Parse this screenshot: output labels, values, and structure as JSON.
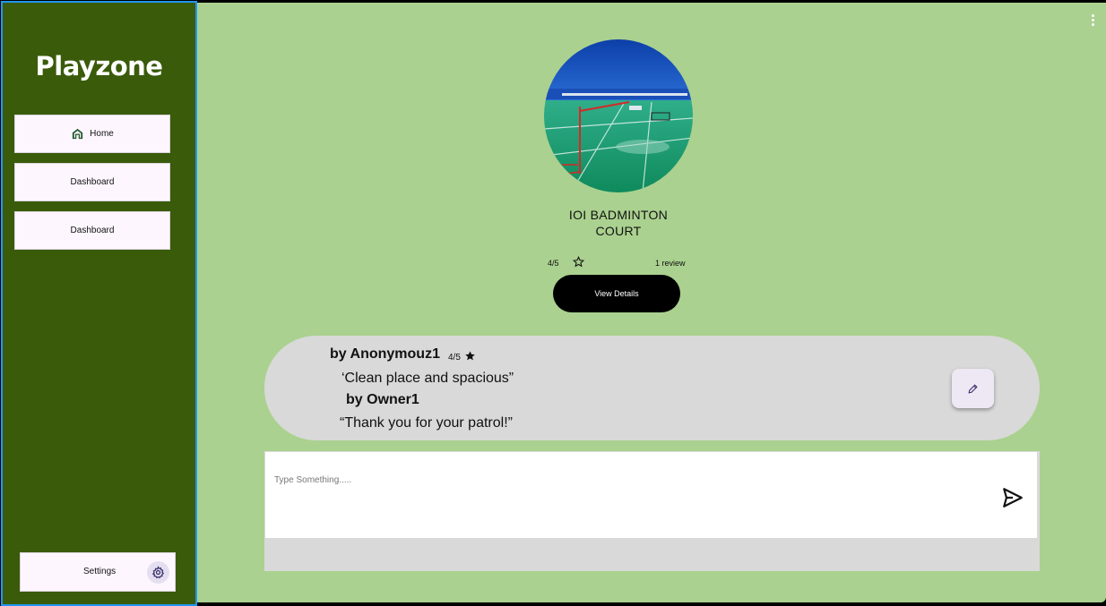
{
  "sidebar": {
    "brand": "Playzone",
    "items": [
      {
        "label": "Home",
        "icon": "home-icon"
      },
      {
        "label": "Dashboard"
      },
      {
        "label": "Dashboard"
      }
    ],
    "settings": {
      "label": "Settings",
      "icon": "gear-icon"
    }
  },
  "court": {
    "name_line1": "IOI BADMINTON",
    "name_line2": "COURT",
    "rating": "4/5",
    "review_count": "1 review",
    "view_details_label": "View Details"
  },
  "review": {
    "author": "by Anonymouz1",
    "rating": "4/5",
    "text": "‘Clean place and spacious”",
    "reply_author": "by Owner1",
    "reply_text": "“Thank you for your patrol!”"
  },
  "compose": {
    "placeholder": "Type Something....."
  },
  "colors": {
    "sidebar_bg": "#3a5b0a",
    "main_bg": "#aad18f",
    "card_bg": "#d9d9d9",
    "button_bg": "#fdf6fe",
    "accent": "#2196f3"
  }
}
